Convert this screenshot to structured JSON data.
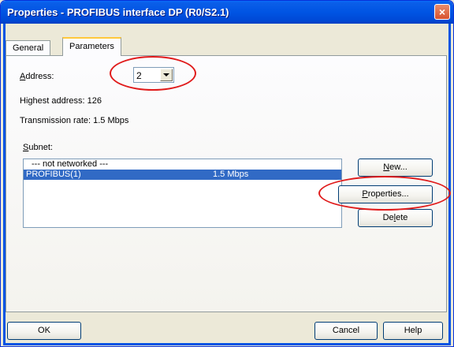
{
  "window": {
    "title": "Properties - PROFIBUS interface  DP (R0/S2.1)",
    "close_label": "×"
  },
  "tabs": [
    {
      "label": "General",
      "active": false
    },
    {
      "label": "Parameters",
      "active": true
    }
  ],
  "address": {
    "label_accel": "A",
    "label_rest": "ddress:",
    "value": "2"
  },
  "highest_address": "Highest address:  126",
  "transmission_rate": "Transmission rate: 1.5 Mbps",
  "subnet": {
    "label_accel": "S",
    "label_rest": "ubnet:",
    "rows": [
      {
        "name": "--- not networked ---",
        "rate": "",
        "selected": false
      },
      {
        "name": "PROFIBUS(1)",
        "rate": "1.5 Mbps",
        "selected": true
      }
    ]
  },
  "buttons": {
    "new_accel": "N",
    "new_rest": "ew...",
    "props_pre": "",
    "props_accel": "P",
    "props_rest": "roperties...",
    "del_pre": "De",
    "del_accel": "l",
    "del_rest": "ete",
    "ok": "OK",
    "cancel": "Cancel",
    "help": "Help"
  },
  "colors": {
    "titlebar": "#0054e3",
    "selection": "#316ac5",
    "annotation": "#e01b1b",
    "dialog_bg": "#ece9d8"
  }
}
